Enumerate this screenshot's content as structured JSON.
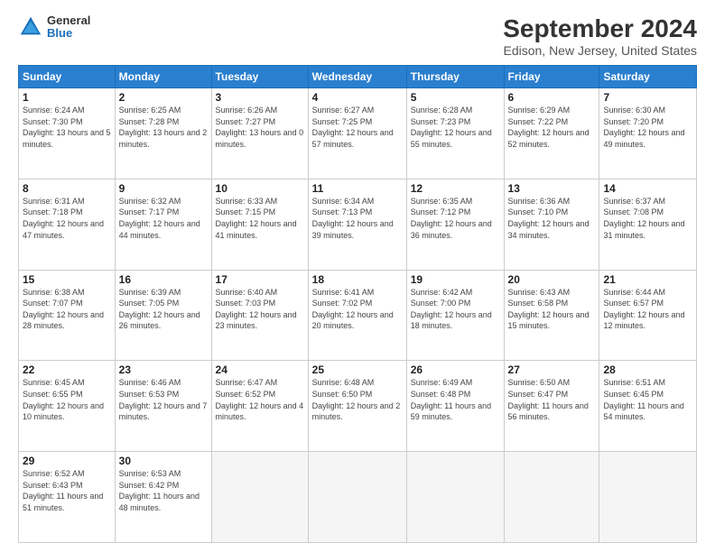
{
  "logo": {
    "general": "General",
    "blue": "Blue"
  },
  "title": "September 2024",
  "location": "Edison, New Jersey, United States",
  "days_of_week": [
    "Sunday",
    "Monday",
    "Tuesday",
    "Wednesday",
    "Thursday",
    "Friday",
    "Saturday"
  ],
  "weeks": [
    [
      {
        "day": "1",
        "sunrise": "6:24 AM",
        "sunset": "7:30 PM",
        "daylight": "13 hours and 5 minutes."
      },
      {
        "day": "2",
        "sunrise": "6:25 AM",
        "sunset": "7:28 PM",
        "daylight": "13 hours and 2 minutes."
      },
      {
        "day": "3",
        "sunrise": "6:26 AM",
        "sunset": "7:27 PM",
        "daylight": "13 hours and 0 minutes."
      },
      {
        "day": "4",
        "sunrise": "6:27 AM",
        "sunset": "7:25 PM",
        "daylight": "12 hours and 57 minutes."
      },
      {
        "day": "5",
        "sunrise": "6:28 AM",
        "sunset": "7:23 PM",
        "daylight": "12 hours and 55 minutes."
      },
      {
        "day": "6",
        "sunrise": "6:29 AM",
        "sunset": "7:22 PM",
        "daylight": "12 hours and 52 minutes."
      },
      {
        "day": "7",
        "sunrise": "6:30 AM",
        "sunset": "7:20 PM",
        "daylight": "12 hours and 49 minutes."
      }
    ],
    [
      {
        "day": "8",
        "sunrise": "6:31 AM",
        "sunset": "7:18 PM",
        "daylight": "12 hours and 47 minutes."
      },
      {
        "day": "9",
        "sunrise": "6:32 AM",
        "sunset": "7:17 PM",
        "daylight": "12 hours and 44 minutes."
      },
      {
        "day": "10",
        "sunrise": "6:33 AM",
        "sunset": "7:15 PM",
        "daylight": "12 hours and 41 minutes."
      },
      {
        "day": "11",
        "sunrise": "6:34 AM",
        "sunset": "7:13 PM",
        "daylight": "12 hours and 39 minutes."
      },
      {
        "day": "12",
        "sunrise": "6:35 AM",
        "sunset": "7:12 PM",
        "daylight": "12 hours and 36 minutes."
      },
      {
        "day": "13",
        "sunrise": "6:36 AM",
        "sunset": "7:10 PM",
        "daylight": "12 hours and 34 minutes."
      },
      {
        "day": "14",
        "sunrise": "6:37 AM",
        "sunset": "7:08 PM",
        "daylight": "12 hours and 31 minutes."
      }
    ],
    [
      {
        "day": "15",
        "sunrise": "6:38 AM",
        "sunset": "7:07 PM",
        "daylight": "12 hours and 28 minutes."
      },
      {
        "day": "16",
        "sunrise": "6:39 AM",
        "sunset": "7:05 PM",
        "daylight": "12 hours and 26 minutes."
      },
      {
        "day": "17",
        "sunrise": "6:40 AM",
        "sunset": "7:03 PM",
        "daylight": "12 hours and 23 minutes."
      },
      {
        "day": "18",
        "sunrise": "6:41 AM",
        "sunset": "7:02 PM",
        "daylight": "12 hours and 20 minutes."
      },
      {
        "day": "19",
        "sunrise": "6:42 AM",
        "sunset": "7:00 PM",
        "daylight": "12 hours and 18 minutes."
      },
      {
        "day": "20",
        "sunrise": "6:43 AM",
        "sunset": "6:58 PM",
        "daylight": "12 hours and 15 minutes."
      },
      {
        "day": "21",
        "sunrise": "6:44 AM",
        "sunset": "6:57 PM",
        "daylight": "12 hours and 12 minutes."
      }
    ],
    [
      {
        "day": "22",
        "sunrise": "6:45 AM",
        "sunset": "6:55 PM",
        "daylight": "12 hours and 10 minutes."
      },
      {
        "day": "23",
        "sunrise": "6:46 AM",
        "sunset": "6:53 PM",
        "daylight": "12 hours and 7 minutes."
      },
      {
        "day": "24",
        "sunrise": "6:47 AM",
        "sunset": "6:52 PM",
        "daylight": "12 hours and 4 minutes."
      },
      {
        "day": "25",
        "sunrise": "6:48 AM",
        "sunset": "6:50 PM",
        "daylight": "12 hours and 2 minutes."
      },
      {
        "day": "26",
        "sunrise": "6:49 AM",
        "sunset": "6:48 PM",
        "daylight": "11 hours and 59 minutes."
      },
      {
        "day": "27",
        "sunrise": "6:50 AM",
        "sunset": "6:47 PM",
        "daylight": "11 hours and 56 minutes."
      },
      {
        "day": "28",
        "sunrise": "6:51 AM",
        "sunset": "6:45 PM",
        "daylight": "11 hours and 54 minutes."
      }
    ],
    [
      {
        "day": "29",
        "sunrise": "6:52 AM",
        "sunset": "6:43 PM",
        "daylight": "11 hours and 51 minutes."
      },
      {
        "day": "30",
        "sunrise": "6:53 AM",
        "sunset": "6:42 PM",
        "daylight": "11 hours and 48 minutes."
      },
      null,
      null,
      null,
      null,
      null
    ]
  ]
}
